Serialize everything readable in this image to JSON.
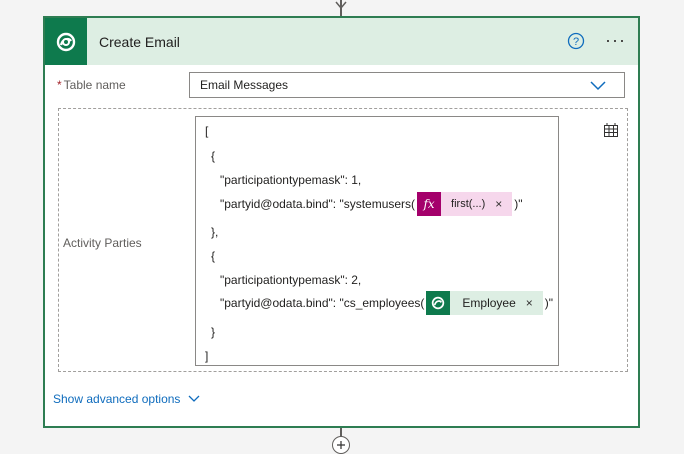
{
  "card": {
    "title": "Create Email",
    "help_icon": "help-circle-icon",
    "more_icon": "more-ellipsis-icon",
    "more_label": "···"
  },
  "table_field": {
    "required_mark": "*",
    "label": "Table name",
    "value": "Email Messages"
  },
  "activity_parties": {
    "label": "Activity Parties",
    "lines": {
      "l1": "[",
      "l2": "{",
      "l3": "\"participationtypemask\": 1,",
      "l4_prefix": "\"partyid@odata.bind\": \"systemusers(",
      "l4_suffix": ")\"",
      "l5": "},",
      "l6": "{",
      "l7": "\"participationtypemask\": 2,",
      "l8_prefix": "\"partyid@odata.bind\": \"cs_employees(",
      "l8_suffix": ")\"",
      "l9": "}",
      "l10": "]"
    },
    "token_expression": {
      "icon": "fx",
      "label": "first(...)",
      "remove": "×"
    },
    "token_employee": {
      "icon": "dataverse-icon",
      "label": "Employee",
      "remove": "×"
    }
  },
  "advanced": {
    "label": "Show advanced options"
  },
  "colors": {
    "header_bg": "#ddeee3",
    "accent_green": "#0e7a4d",
    "fx_magenta": "#a4006b",
    "link_blue": "#0f6cbd"
  }
}
